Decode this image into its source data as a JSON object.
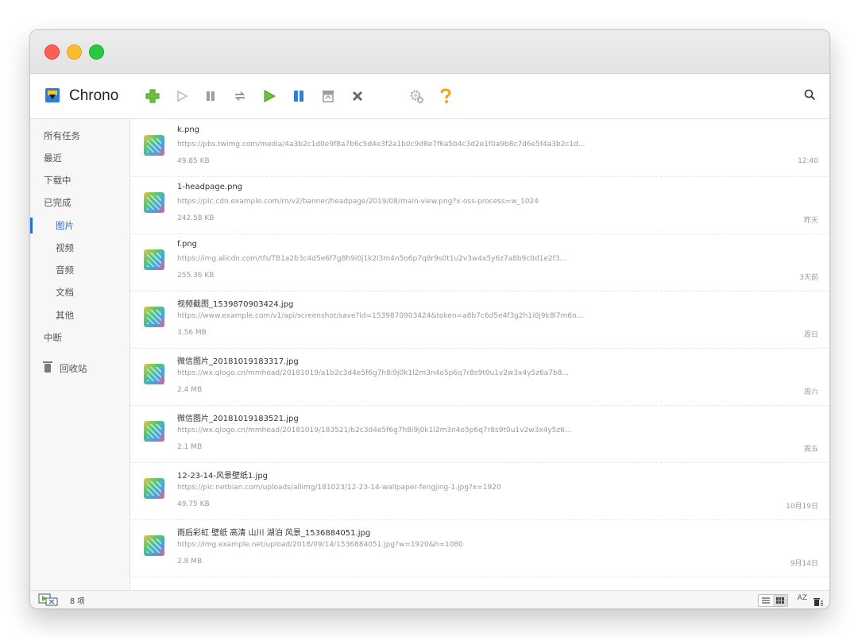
{
  "app": {
    "title": "Chrono"
  },
  "toolbar": [
    {
      "name": "add-task-button",
      "icon": "plus-icon"
    },
    {
      "name": "start-button",
      "icon": "play-icon"
    },
    {
      "name": "pause-button",
      "icon": "pause-icon"
    },
    {
      "name": "retry-button",
      "icon": "refresh-icon"
    },
    {
      "name": "start-all-button",
      "icon": "play-all-icon"
    },
    {
      "name": "pause-all-button",
      "icon": "pause-all-icon"
    },
    {
      "name": "archive-button",
      "icon": "archive-icon"
    },
    {
      "name": "delete-button",
      "icon": "close-icon"
    },
    {
      "name": "settings-button",
      "icon": "gear-icon"
    },
    {
      "name": "help-button",
      "icon": "help-icon"
    }
  ],
  "sidebar": {
    "items": [
      {
        "label": "所有任务",
        "level": "top"
      },
      {
        "label": "最近",
        "level": "top"
      },
      {
        "label": "下载中",
        "level": "top"
      },
      {
        "label": "已完成",
        "level": "top"
      },
      {
        "label": "图片",
        "level": "sub",
        "active": true
      },
      {
        "label": "视频",
        "level": "sub"
      },
      {
        "label": "音频",
        "level": "sub"
      },
      {
        "label": "文档",
        "level": "sub"
      },
      {
        "label": "其他",
        "level": "sub"
      },
      {
        "label": "中断",
        "level": "top"
      }
    ],
    "trash": "回收站"
  },
  "downloads": [
    {
      "name": "k.png",
      "url": "https://pbs.twimg.com/media/4a3b2c1d0e9f8a7b6c5d4e3f2a1b0c9d8e7f6a5b4c3d2e1f0a9b8c7d6e5f4a3b2c1d...",
      "size": "49.85 KB",
      "time": "12:40"
    },
    {
      "name": "1-headpage.png",
      "url": "https://pic.cdn.example.com/rn/v2/banner/headpage/2019/08/main-view.png?x-oss-process=w_1024",
      "size": "242.58 KB",
      "time": "昨天"
    },
    {
      "name": "f.png",
      "url": "https://img.alicdn.com/tfs/TB1a2b3c4d5e6f7g8h9i0j1k2l3m4n5o6p7q8r9s0t1u2v3w4x5y6z7a8b9c0d1e2f3...",
      "size": "255.36 KB",
      "time": "3天前"
    },
    {
      "name": "视频截图_1539870903424.jpg",
      "url": "https://www.example.com/v1/api/screenshot/save?id=1539870903424&token=a8b7c6d5e4f3g2h1i0j9k8l7m6n...",
      "size": "3.56 MB",
      "time": "周日"
    },
    {
      "name": "微信图片_20181019183317.jpg",
      "url": "https://wx.qlogo.cn/mmhead/20181019/a1b2c3d4e5f6g7h8i9j0k1l2m3n4o5p6q7r8s9t0u1v2w3x4y5z6a7b8...",
      "size": "2.4 MB",
      "time": "周六"
    },
    {
      "name": "微信图片_20181019183521.jpg",
      "url": "https://wx.qlogo.cn/mmhead/20181019/183521/b2c3d4e5f6g7h8i9j0k1l2m3n4o5p6q7r8s9t0u1v2w3x4y5z6...",
      "size": "2.1 MB",
      "time": "周五"
    },
    {
      "name": "12-23-14-风景壁纸1.jpg",
      "url": "https://pic.netbian.com/uploads/allimg/181023/12-23-14-wallpaper-fengjing-1.jpg?x=1920",
      "size": "49.75 KB",
      "time": "10月19日"
    },
    {
      "name": "雨后彩虹 壁纸 高清 山川 湖泊 风景_1536884051.jpg",
      "url": "https://img.example.net/upload/2018/09/14/1536884051.jpg?w=1920&h=1080",
      "size": "2.8 MB",
      "time": "9月14日"
    }
  ],
  "status": {
    "count": "8 项",
    "sort_label": "AZ"
  },
  "colors": {
    "accent": "#2a6fcf",
    "green": "#5db82b",
    "blue": "#2f7fd6",
    "orange": "#f0a020"
  }
}
